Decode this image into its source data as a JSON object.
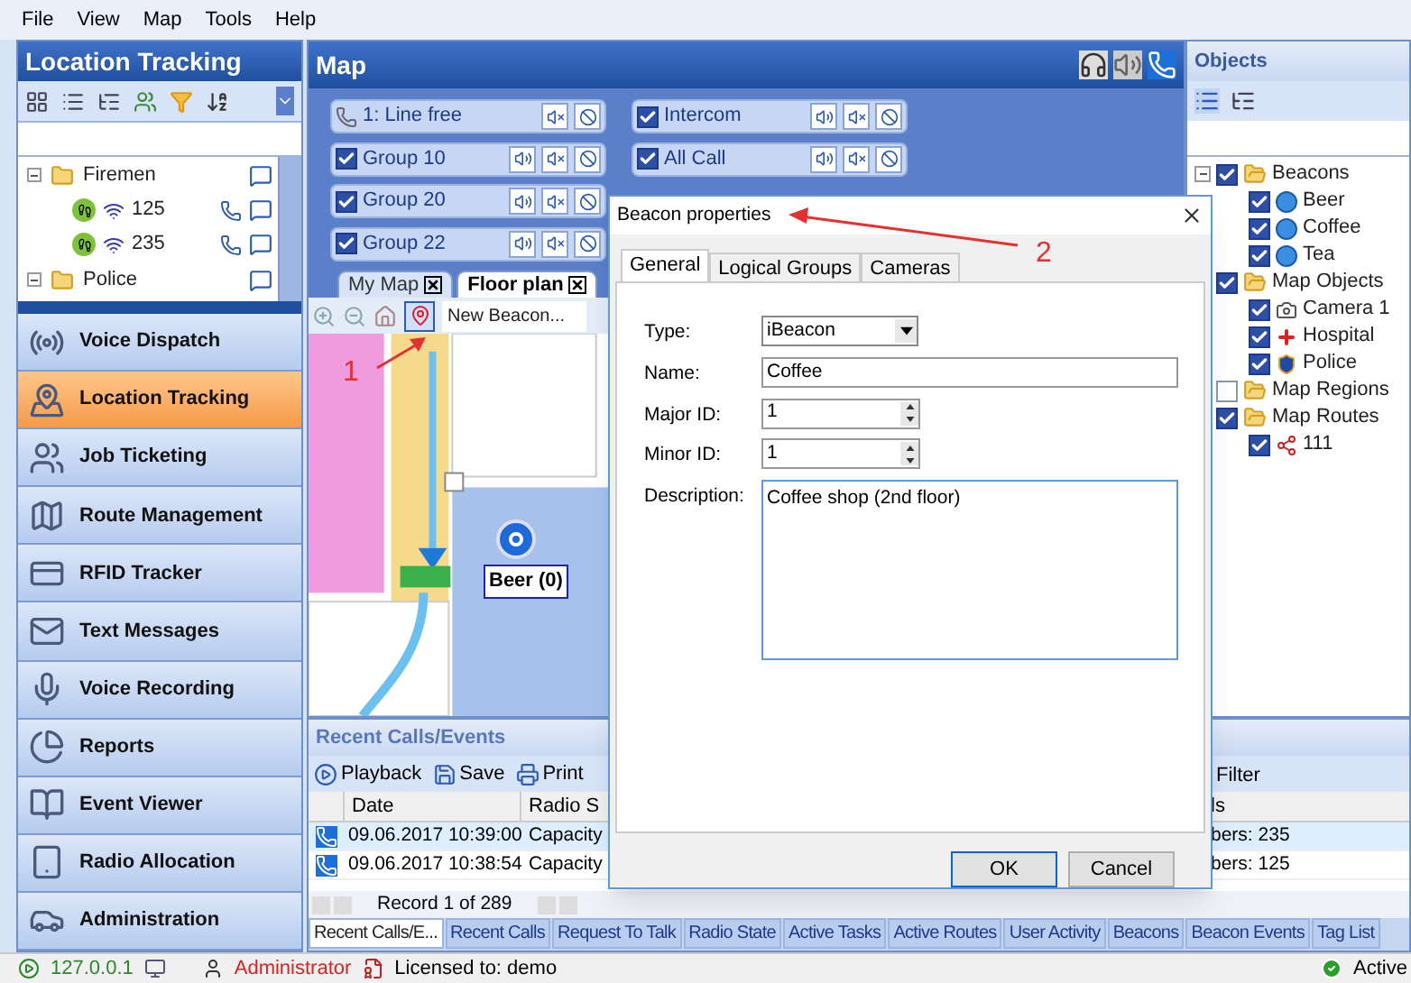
{
  "menu": [
    {
      "label": "File"
    },
    {
      "label": "View"
    },
    {
      "label": "Map"
    },
    {
      "label": "Tools"
    },
    {
      "label": "Help"
    }
  ],
  "left_panel": {
    "title": "Location Tracking",
    "tree": [
      {
        "label": "Firemen",
        "kind": "folder",
        "expanded": true,
        "children": [
          {
            "label": "125",
            "kind": "unit"
          },
          {
            "label": "235",
            "kind": "unit"
          }
        ]
      },
      {
        "label": "Police",
        "kind": "folder",
        "expanded": true
      }
    ],
    "nav": [
      {
        "label": "Voice Dispatch",
        "selected": false
      },
      {
        "label": "Location Tracking",
        "selected": true
      },
      {
        "label": "Job Ticketing",
        "selected": false
      },
      {
        "label": "Route Management",
        "selected": false
      },
      {
        "label": "RFID Tracker",
        "selected": false
      },
      {
        "label": "Text Messages",
        "selected": false
      },
      {
        "label": "Voice Recording",
        "selected": false
      },
      {
        "label": "Reports",
        "selected": false
      },
      {
        "label": "Event Viewer",
        "selected": false
      },
      {
        "label": "Radio Allocation",
        "selected": false
      },
      {
        "label": "Administration",
        "selected": false
      }
    ]
  },
  "map_panel": {
    "title": "Map",
    "groups": [
      {
        "label": "1: Line free",
        "kind": "line"
      },
      {
        "label": "Group 10",
        "kind": "group",
        "checked": true
      },
      {
        "label": "Group 20",
        "kind": "group",
        "checked": true
      },
      {
        "label": "Group 22",
        "kind": "group",
        "checked": true
      },
      {
        "label": "Intercom",
        "kind": "group",
        "checked": true
      },
      {
        "label": "All Call",
        "kind": "group",
        "checked": true
      }
    ],
    "tabs": [
      {
        "label": "My Map",
        "selected": false
      },
      {
        "label": "Floor plan",
        "selected": true
      }
    ],
    "beacon_field": "New Beacon...",
    "markers": [
      {
        "label": "Beer (0)"
      }
    ]
  },
  "annotations": [
    {
      "label": "1"
    },
    {
      "label": "2"
    }
  ],
  "objects_panel": {
    "title": "Objects",
    "tree": [
      {
        "label": "Beacons",
        "checked": true,
        "children": [
          {
            "label": "Beer",
            "checked": true,
            "kind": "beacon"
          },
          {
            "label": "Coffee",
            "checked": true,
            "kind": "beacon"
          },
          {
            "label": "Tea",
            "checked": true,
            "kind": "beacon"
          }
        ]
      },
      {
        "label": "Map Objects",
        "checked": true,
        "children": [
          {
            "label": "Camera 1",
            "checked": true,
            "kind": "camera"
          },
          {
            "label": "Hospital",
            "checked": true,
            "kind": "hospital"
          },
          {
            "label": "Police",
            "checked": true,
            "kind": "police"
          }
        ]
      },
      {
        "label": "Map Regions",
        "checked": false
      },
      {
        "label": "Map Routes",
        "checked": true,
        "children": [
          {
            "label": "111",
            "checked": true,
            "kind": "route"
          }
        ]
      }
    ]
  },
  "dialog": {
    "title": "Beacon properties",
    "tabs": [
      {
        "label": "General",
        "selected": true
      },
      {
        "label": "Logical Groups",
        "selected": false
      },
      {
        "label": "Cameras",
        "selected": false
      }
    ],
    "fields": [
      {
        "label": "Type:",
        "value": "iBeacon",
        "kind": "select"
      },
      {
        "label": "Name:",
        "value": "Coffee",
        "kind": "text"
      },
      {
        "label": "Major ID:",
        "value": "1",
        "kind": "spin"
      },
      {
        "label": "Minor ID:",
        "value": "1",
        "kind": "spin"
      },
      {
        "label": "Description:",
        "value": "Coffee shop (2nd floor)",
        "kind": "textarea"
      }
    ],
    "buttons": [
      "OK",
      "Cancel"
    ]
  },
  "events_panel": {
    "title": "Recent Calls/Events",
    "toolbar": [
      {
        "label": "Playback"
      },
      {
        "label": "Save"
      },
      {
        "label": "Print"
      }
    ],
    "filter": "Filter",
    "columns": [
      {
        "label": "Date"
      },
      {
        "label": "Radio S"
      },
      {
        "label": "ls"
      }
    ],
    "rows": [
      {
        "date": "09.06.2017 10:39:00",
        "radio": "Capacity",
        "detail": "bers: 235",
        "selected": true
      },
      {
        "date": "09.06.2017 10:38:54",
        "radio": "Capacity",
        "detail": "bers: 125",
        "selected": false
      }
    ],
    "pager": "Record 1 of 289",
    "tabs": [
      {
        "label": "Recent Calls/E...",
        "selected": true
      },
      {
        "label": "Recent Calls",
        "selected": false
      },
      {
        "label": "Request To Talk",
        "selected": false
      },
      {
        "label": "Radio State",
        "selected": false
      },
      {
        "label": "Active Tasks",
        "selected": false
      },
      {
        "label": "Active Routes",
        "selected": false
      },
      {
        "label": "User Activity",
        "selected": false
      },
      {
        "label": "Beacons",
        "selected": false
      },
      {
        "label": "Beacon Events",
        "selected": false
      },
      {
        "label": "Tag List",
        "selected": false
      }
    ]
  },
  "status_bar": {
    "address": "127.0.0.1",
    "user": "Administrator",
    "license": "Licensed to: demo",
    "state": "Active"
  }
}
